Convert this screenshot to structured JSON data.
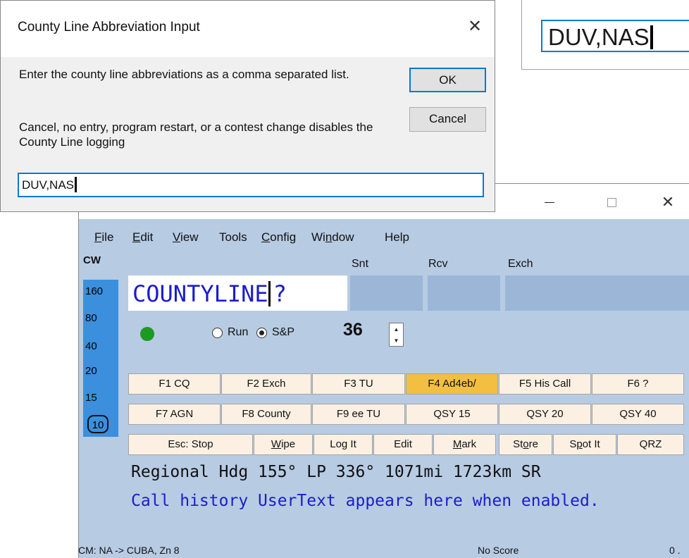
{
  "zoom_inset": {
    "value": "DUV,NAS"
  },
  "dialog": {
    "title": "County Line Abbreviation Input",
    "close_glyph": "✕",
    "prompt": "Enter the county line abbreviations as a comma separated list.",
    "note": "Cancel, no entry, program restart, or a contest change disables the County Line logging",
    "ok_label": "OK",
    "cancel_label": "Cancel",
    "input_value": "DUV,NAS"
  },
  "app": {
    "window_controls": {
      "close": "✕"
    },
    "menu": {
      "file": {
        "first": "F",
        "rest": "ile"
      },
      "edit": {
        "first": "E",
        "rest": "dit"
      },
      "view": {
        "first": "V",
        "rest": "iew"
      },
      "tools": "Tools",
      "config": {
        "first": "C",
        "rest": "onfig"
      },
      "window": {
        "pre": "Wi",
        "ul": "n",
        "post": "dow"
      },
      "help": "Help"
    },
    "mode": "CW",
    "bands": [
      "160",
      "80",
      "40",
      "20",
      "15",
      "10"
    ],
    "selected_band": "10",
    "column_headers": {
      "snt": "Snt",
      "rcv": "Rcv",
      "exch": "Exch"
    },
    "call_field": {
      "text": "COUNTYLINE",
      "suffix": "?"
    },
    "status_indicator_color": "#1c9a22",
    "radio": {
      "run": "Run",
      "sp": "S&P",
      "selected": "S&P"
    },
    "power": "36",
    "spinner": {
      "up": "▲",
      "down": "▼"
    },
    "function_keys_row1": [
      "F1 CQ",
      "F2 Exch",
      "F3 TU",
      "F4 Ad4eb/",
      "F5 His Call",
      "F6 ?"
    ],
    "function_keys_row2": [
      "F7 AGN",
      "F8 County",
      "F9 ee TU",
      "QSY 15",
      "QSY 20",
      "QSY 40"
    ],
    "highlighted_key": "F4 Ad4eb/",
    "action_buttons": {
      "esc": "Esc: Stop",
      "wipe": {
        "first": "W",
        "rest": "ipe"
      },
      "log": "Log It",
      "edit": "Edit",
      "mark": {
        "first": "M",
        "rest": "ark"
      },
      "store": {
        "pre": "St",
        "ul": "o",
        "post": "re"
      },
      "spot": {
        "pre": "S",
        "ul": "p",
        "post": "ot It"
      },
      "qrz": "QRZ"
    },
    "rate_line": "Regional Hdg 155° LP 336° 1071mi 1723km SR",
    "usertext_line": "Call history UserText appears here when enabled.",
    "status_bar": {
      "left": "CM: NA -> CUBA, Zn 8",
      "center": "No Score",
      "right": "0 ."
    }
  },
  "colors": {
    "app_background": "#b7cbe3",
    "band_column": "#3b8fdc",
    "call_text": "#1c1ccc",
    "highlight_key": "#f3bf43",
    "focus_border": "#0a79d6"
  }
}
